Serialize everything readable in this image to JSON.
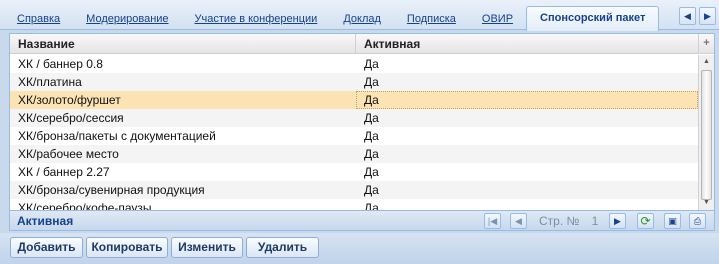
{
  "tabs": [
    {
      "label": "Справка",
      "active": false
    },
    {
      "label": "Модерирование",
      "active": false
    },
    {
      "label": "Участие в конференции",
      "active": false
    },
    {
      "label": "Доклад",
      "active": false
    },
    {
      "label": "Подписка",
      "active": false
    },
    {
      "label": "ОВИР",
      "active": false
    },
    {
      "label": "Спонсорский пакет",
      "active": true
    }
  ],
  "tab_scroll": {
    "left_icon": "triangle-left-icon",
    "right_icon": "triangle-right-icon"
  },
  "grid": {
    "columns": [
      "Название",
      "Активная"
    ],
    "rows": [
      {
        "name": "ХК / баннер 0.8",
        "active": "Да"
      },
      {
        "name": "ХК/платина",
        "active": "Да"
      },
      {
        "name": "ХК/золото/фуршет",
        "active": "Да",
        "selected": true
      },
      {
        "name": "ХК/серебро/сессия",
        "active": "Да"
      },
      {
        "name": "ХК/бронза/пакеты с документацией",
        "active": "Да"
      },
      {
        "name": "ХК/рабочее место",
        "active": "Да"
      },
      {
        "name": "ХК / баннер 2.27",
        "active": "Да"
      },
      {
        "name": "ХК/бронза/сувенирная продукция",
        "active": "Да"
      },
      {
        "name": "ХК/серебро/кофе-паузы",
        "active": "Да"
      }
    ]
  },
  "pager": {
    "title": "Активная",
    "page_label": "Стр. №",
    "page_number": "1"
  },
  "toolbar": {
    "add_label": "Добавить",
    "copy_label": "Копировать",
    "edit_label": "Изменить",
    "delete_label": "Удалить"
  },
  "colors": {
    "accent": "#15428b",
    "border": "#99bbe8",
    "selected_row": "#fbe3b4"
  }
}
